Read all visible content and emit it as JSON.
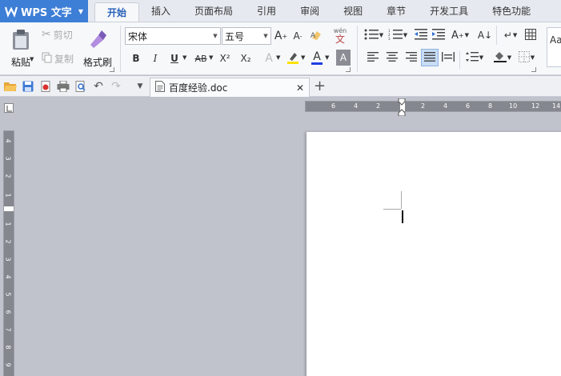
{
  "app": {
    "name": "WPS 文字",
    "colors": {
      "accent": "#3d7ed6",
      "active_tab_text": "#2a62b8",
      "workspace": "#c0c2cc"
    }
  },
  "menu": {
    "tabs": [
      {
        "label": "开始",
        "active": true
      },
      {
        "label": "插入"
      },
      {
        "label": "页面布局"
      },
      {
        "label": "引用"
      },
      {
        "label": "审阅"
      },
      {
        "label": "视图"
      },
      {
        "label": "章节"
      },
      {
        "label": "开发工具"
      },
      {
        "label": "特色功能"
      }
    ]
  },
  "ribbon": {
    "paste_label": "粘贴",
    "cut_label": "剪切",
    "copy_label": "复制",
    "format_painter_label": "格式刷",
    "font_name": "宋体",
    "font_size": "五号",
    "bold": "B",
    "italic": "I",
    "underline": "U",
    "strike": "AB",
    "superscript": "X²",
    "subscript": "X₂",
    "font_color_letter": "A",
    "wen_label": "wén",
    "wen_char": "文",
    "style_preview": "Aa"
  },
  "quickbar": {
    "document_tab": "百度经验.doc"
  },
  "ruler": {
    "h_left_numbers": [
      "6",
      "4",
      "2"
    ],
    "h_right_numbers": [
      "2",
      "4",
      "6",
      "8",
      "10",
      "12",
      "14"
    ],
    "v_top_numbers": [
      "4",
      "3",
      "2",
      "1"
    ],
    "v_bottom_numbers": [
      "1",
      "2",
      "3",
      "4",
      "5",
      "6",
      "7",
      "8",
      "9"
    ]
  }
}
